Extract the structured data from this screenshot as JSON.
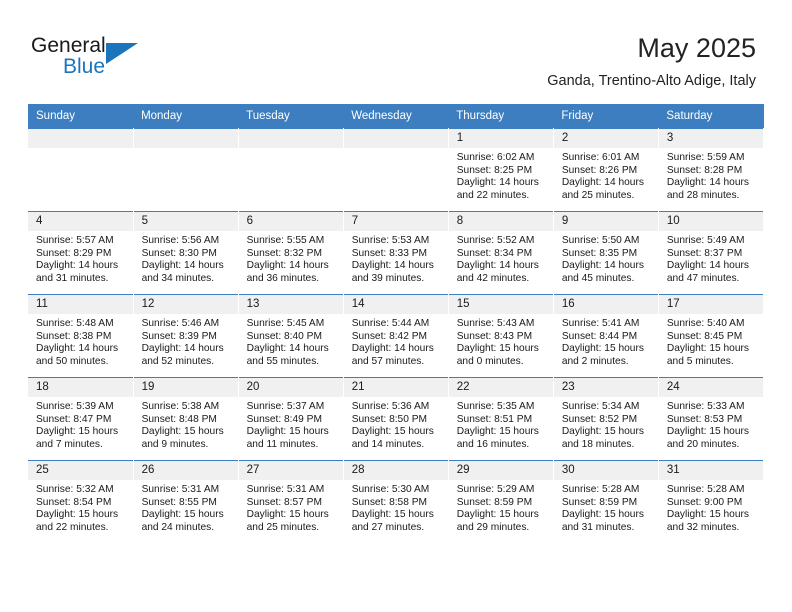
{
  "brand": {
    "name_part1": "General",
    "name_part2": "Blue",
    "accent_color": "#1c75bc"
  },
  "header": {
    "month_title": "May 2025",
    "location": "Ganda, Trentino-Alto Adige, Italy"
  },
  "calendar": {
    "header_color": "#3c7ebf",
    "weekday_headers": [
      "Sunday",
      "Monday",
      "Tuesday",
      "Wednesday",
      "Thursday",
      "Friday",
      "Saturday"
    ],
    "weeks": [
      [
        {
          "day": "",
          "sunrise": "",
          "sunset": "",
          "daylight_line1": "",
          "daylight_line2": ""
        },
        {
          "day": "",
          "sunrise": "",
          "sunset": "",
          "daylight_line1": "",
          "daylight_line2": ""
        },
        {
          "day": "",
          "sunrise": "",
          "sunset": "",
          "daylight_line1": "",
          "daylight_line2": ""
        },
        {
          "day": "",
          "sunrise": "",
          "sunset": "",
          "daylight_line1": "",
          "daylight_line2": ""
        },
        {
          "day": "1",
          "sunrise": "Sunrise: 6:02 AM",
          "sunset": "Sunset: 8:25 PM",
          "daylight_line1": "Daylight: 14 hours",
          "daylight_line2": "and 22 minutes."
        },
        {
          "day": "2",
          "sunrise": "Sunrise: 6:01 AM",
          "sunset": "Sunset: 8:26 PM",
          "daylight_line1": "Daylight: 14 hours",
          "daylight_line2": "and 25 minutes."
        },
        {
          "day": "3",
          "sunrise": "Sunrise: 5:59 AM",
          "sunset": "Sunset: 8:28 PM",
          "daylight_line1": "Daylight: 14 hours",
          "daylight_line2": "and 28 minutes."
        }
      ],
      [
        {
          "day": "4",
          "sunrise": "Sunrise: 5:57 AM",
          "sunset": "Sunset: 8:29 PM",
          "daylight_line1": "Daylight: 14 hours",
          "daylight_line2": "and 31 minutes."
        },
        {
          "day": "5",
          "sunrise": "Sunrise: 5:56 AM",
          "sunset": "Sunset: 8:30 PM",
          "daylight_line1": "Daylight: 14 hours",
          "daylight_line2": "and 34 minutes."
        },
        {
          "day": "6",
          "sunrise": "Sunrise: 5:55 AM",
          "sunset": "Sunset: 8:32 PM",
          "daylight_line1": "Daylight: 14 hours",
          "daylight_line2": "and 36 minutes."
        },
        {
          "day": "7",
          "sunrise": "Sunrise: 5:53 AM",
          "sunset": "Sunset: 8:33 PM",
          "daylight_line1": "Daylight: 14 hours",
          "daylight_line2": "and 39 minutes."
        },
        {
          "day": "8",
          "sunrise": "Sunrise: 5:52 AM",
          "sunset": "Sunset: 8:34 PM",
          "daylight_line1": "Daylight: 14 hours",
          "daylight_line2": "and 42 minutes."
        },
        {
          "day": "9",
          "sunrise": "Sunrise: 5:50 AM",
          "sunset": "Sunset: 8:35 PM",
          "daylight_line1": "Daylight: 14 hours",
          "daylight_line2": "and 45 minutes."
        },
        {
          "day": "10",
          "sunrise": "Sunrise: 5:49 AM",
          "sunset": "Sunset: 8:37 PM",
          "daylight_line1": "Daylight: 14 hours",
          "daylight_line2": "and 47 minutes."
        }
      ],
      [
        {
          "day": "11",
          "sunrise": "Sunrise: 5:48 AM",
          "sunset": "Sunset: 8:38 PM",
          "daylight_line1": "Daylight: 14 hours",
          "daylight_line2": "and 50 minutes."
        },
        {
          "day": "12",
          "sunrise": "Sunrise: 5:46 AM",
          "sunset": "Sunset: 8:39 PM",
          "daylight_line1": "Daylight: 14 hours",
          "daylight_line2": "and 52 minutes."
        },
        {
          "day": "13",
          "sunrise": "Sunrise: 5:45 AM",
          "sunset": "Sunset: 8:40 PM",
          "daylight_line1": "Daylight: 14 hours",
          "daylight_line2": "and 55 minutes."
        },
        {
          "day": "14",
          "sunrise": "Sunrise: 5:44 AM",
          "sunset": "Sunset: 8:42 PM",
          "daylight_line1": "Daylight: 14 hours",
          "daylight_line2": "and 57 minutes."
        },
        {
          "day": "15",
          "sunrise": "Sunrise: 5:43 AM",
          "sunset": "Sunset: 8:43 PM",
          "daylight_line1": "Daylight: 15 hours",
          "daylight_line2": "and 0 minutes."
        },
        {
          "day": "16",
          "sunrise": "Sunrise: 5:41 AM",
          "sunset": "Sunset: 8:44 PM",
          "daylight_line1": "Daylight: 15 hours",
          "daylight_line2": "and 2 minutes."
        },
        {
          "day": "17",
          "sunrise": "Sunrise: 5:40 AM",
          "sunset": "Sunset: 8:45 PM",
          "daylight_line1": "Daylight: 15 hours",
          "daylight_line2": "and 5 minutes."
        }
      ],
      [
        {
          "day": "18",
          "sunrise": "Sunrise: 5:39 AM",
          "sunset": "Sunset: 8:47 PM",
          "daylight_line1": "Daylight: 15 hours",
          "daylight_line2": "and 7 minutes."
        },
        {
          "day": "19",
          "sunrise": "Sunrise: 5:38 AM",
          "sunset": "Sunset: 8:48 PM",
          "daylight_line1": "Daylight: 15 hours",
          "daylight_line2": "and 9 minutes."
        },
        {
          "day": "20",
          "sunrise": "Sunrise: 5:37 AM",
          "sunset": "Sunset: 8:49 PM",
          "daylight_line1": "Daylight: 15 hours",
          "daylight_line2": "and 11 minutes."
        },
        {
          "day": "21",
          "sunrise": "Sunrise: 5:36 AM",
          "sunset": "Sunset: 8:50 PM",
          "daylight_line1": "Daylight: 15 hours",
          "daylight_line2": "and 14 minutes."
        },
        {
          "day": "22",
          "sunrise": "Sunrise: 5:35 AM",
          "sunset": "Sunset: 8:51 PM",
          "daylight_line1": "Daylight: 15 hours",
          "daylight_line2": "and 16 minutes."
        },
        {
          "day": "23",
          "sunrise": "Sunrise: 5:34 AM",
          "sunset": "Sunset: 8:52 PM",
          "daylight_line1": "Daylight: 15 hours",
          "daylight_line2": "and 18 minutes."
        },
        {
          "day": "24",
          "sunrise": "Sunrise: 5:33 AM",
          "sunset": "Sunset: 8:53 PM",
          "daylight_line1": "Daylight: 15 hours",
          "daylight_line2": "and 20 minutes."
        }
      ],
      [
        {
          "day": "25",
          "sunrise": "Sunrise: 5:32 AM",
          "sunset": "Sunset: 8:54 PM",
          "daylight_line1": "Daylight: 15 hours",
          "daylight_line2": "and 22 minutes."
        },
        {
          "day": "26",
          "sunrise": "Sunrise: 5:31 AM",
          "sunset": "Sunset: 8:55 PM",
          "daylight_line1": "Daylight: 15 hours",
          "daylight_line2": "and 24 minutes."
        },
        {
          "day": "27",
          "sunrise": "Sunrise: 5:31 AM",
          "sunset": "Sunset: 8:57 PM",
          "daylight_line1": "Daylight: 15 hours",
          "daylight_line2": "and 25 minutes."
        },
        {
          "day": "28",
          "sunrise": "Sunrise: 5:30 AM",
          "sunset": "Sunset: 8:58 PM",
          "daylight_line1": "Daylight: 15 hours",
          "daylight_line2": "and 27 minutes."
        },
        {
          "day": "29",
          "sunrise": "Sunrise: 5:29 AM",
          "sunset": "Sunset: 8:59 PM",
          "daylight_line1": "Daylight: 15 hours",
          "daylight_line2": "and 29 minutes."
        },
        {
          "day": "30",
          "sunrise": "Sunrise: 5:28 AM",
          "sunset": "Sunset: 8:59 PM",
          "daylight_line1": "Daylight: 15 hours",
          "daylight_line2": "and 31 minutes."
        },
        {
          "day": "31",
          "sunrise": "Sunrise: 5:28 AM",
          "sunset": "Sunset: 9:00 PM",
          "daylight_line1": "Daylight: 15 hours",
          "daylight_line2": "and 32 minutes."
        }
      ]
    ]
  }
}
